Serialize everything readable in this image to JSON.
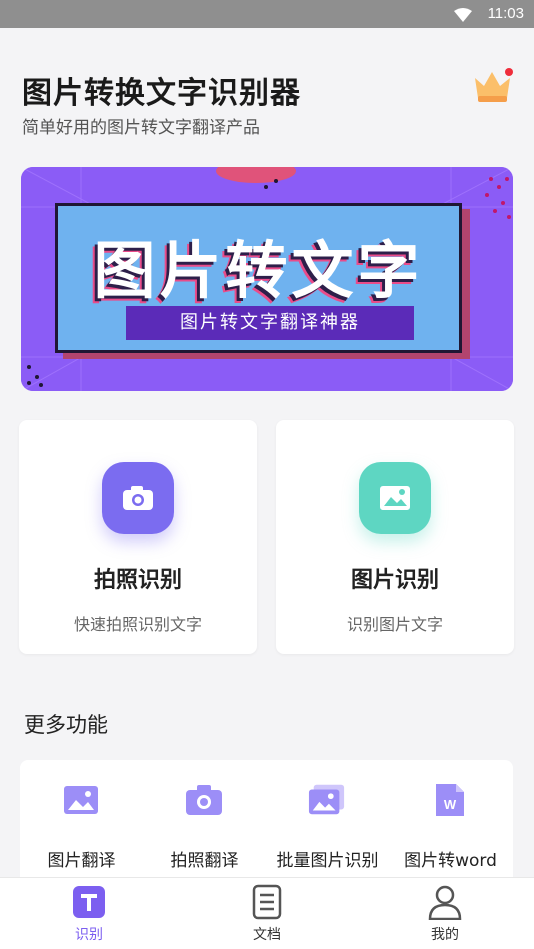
{
  "status_bar": {
    "time": "11:03",
    "icons": [
      "wifi-icon"
    ]
  },
  "header": {
    "title": "图片转换文字识别器",
    "subtitle": "简单好用的图片转文字翻译产品",
    "vip_icon": "crown-icon"
  },
  "banner": {
    "headline": "图片转文字",
    "tagline": "图片转文字翻译神器"
  },
  "cards": [
    {
      "title": "拍照识别",
      "subtitle": "快速拍照识别文字",
      "icon": "camera-icon",
      "color": "#7b6cf0"
    },
    {
      "title": "图片识别",
      "subtitle": "识别图片文字",
      "icon": "image-icon",
      "color": "#5ed6c2"
    }
  ],
  "more": {
    "title": "更多功能",
    "items": [
      {
        "label": "图片翻译",
        "icon": "image-icon"
      },
      {
        "label": "拍照翻译",
        "icon": "camera-icon"
      },
      {
        "label": "批量图片识别",
        "icon": "images-stack-icon"
      },
      {
        "label": "图片转word",
        "icon": "word-file-icon"
      }
    ]
  },
  "tabbar": {
    "active_color": "#7c5ff0",
    "items": [
      {
        "label": "识别",
        "icon": "text-t-icon",
        "active": true
      },
      {
        "label": "文档",
        "icon": "document-icon",
        "active": false
      },
      {
        "label": "我的",
        "icon": "user-icon",
        "active": false
      }
    ]
  }
}
